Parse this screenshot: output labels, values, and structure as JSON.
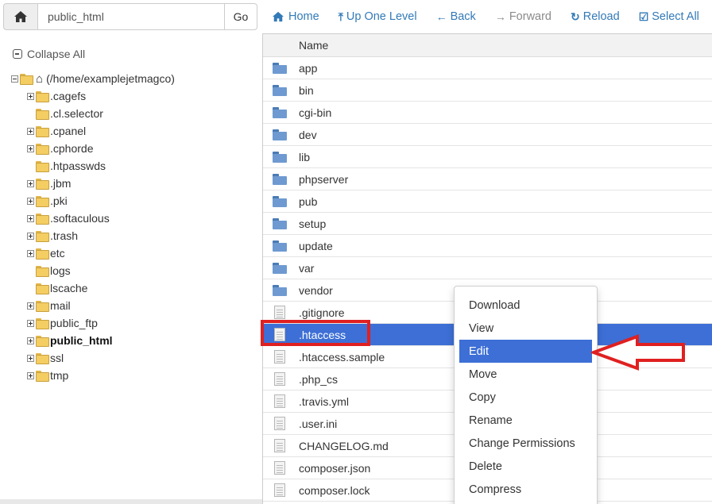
{
  "path_bar": {
    "path_value": "public_html",
    "go_label": "Go"
  },
  "toolbar": {
    "home": "Home",
    "up_one_level": "Up One Level",
    "back": "Back",
    "forward": "Forward",
    "reload": "Reload",
    "select_all": "Select All"
  },
  "tree": {
    "collapse_all": "Collapse All",
    "root": "(/home/examplejetmagco)",
    "items": [
      {
        "label": ".cagefs",
        "expandable": true
      },
      {
        "label": ".cl.selector",
        "expandable": false
      },
      {
        "label": ".cpanel",
        "expandable": true
      },
      {
        "label": ".cphorde",
        "expandable": true
      },
      {
        "label": ".htpasswds",
        "expandable": false
      },
      {
        "label": ".jbm",
        "expandable": true
      },
      {
        "label": ".pki",
        "expandable": true
      },
      {
        "label": ".softaculous",
        "expandable": true
      },
      {
        "label": ".trash",
        "expandable": true
      },
      {
        "label": "etc",
        "expandable": true
      },
      {
        "label": "logs",
        "expandable": false
      },
      {
        "label": "lscache",
        "expandable": false
      },
      {
        "label": "mail",
        "expandable": true
      },
      {
        "label": "public_ftp",
        "expandable": true
      },
      {
        "label": "public_html",
        "expandable": true,
        "current": true
      },
      {
        "label": "ssl",
        "expandable": true
      },
      {
        "label": "tmp",
        "expandable": true
      }
    ]
  },
  "file_list": {
    "column_name": "Name",
    "rows": [
      {
        "name": "app",
        "type": "folder"
      },
      {
        "name": "bin",
        "type": "folder"
      },
      {
        "name": "cgi-bin",
        "type": "folder"
      },
      {
        "name": "dev",
        "type": "folder"
      },
      {
        "name": "lib",
        "type": "folder"
      },
      {
        "name": "phpserver",
        "type": "folder"
      },
      {
        "name": "pub",
        "type": "folder"
      },
      {
        "name": "setup",
        "type": "folder"
      },
      {
        "name": "update",
        "type": "folder"
      },
      {
        "name": "var",
        "type": "folder"
      },
      {
        "name": "vendor",
        "type": "folder"
      },
      {
        "name": ".gitignore",
        "type": "file"
      },
      {
        "name": ".htaccess",
        "type": "file",
        "selected": true
      },
      {
        "name": ".htaccess.sample",
        "type": "file"
      },
      {
        "name": ".php_cs",
        "type": "file"
      },
      {
        "name": ".travis.yml",
        "type": "file"
      },
      {
        "name": ".user.ini",
        "type": "file"
      },
      {
        "name": "CHANGELOG.md",
        "type": "file"
      },
      {
        "name": "composer.json",
        "type": "file"
      },
      {
        "name": "composer.lock",
        "type": "file"
      }
    ]
  },
  "context_menu": {
    "items": [
      {
        "label": "Download"
      },
      {
        "label": "View"
      },
      {
        "label": "Edit",
        "active": true
      },
      {
        "label": "Move"
      },
      {
        "label": "Copy"
      },
      {
        "label": "Rename"
      },
      {
        "label": "Change Permissions"
      },
      {
        "label": "Delete"
      },
      {
        "label": "Compress"
      }
    ]
  },
  "colors": {
    "link_blue": "#337ab7",
    "selection_blue": "#3d6fd6",
    "annotation_red": "#e02020"
  }
}
